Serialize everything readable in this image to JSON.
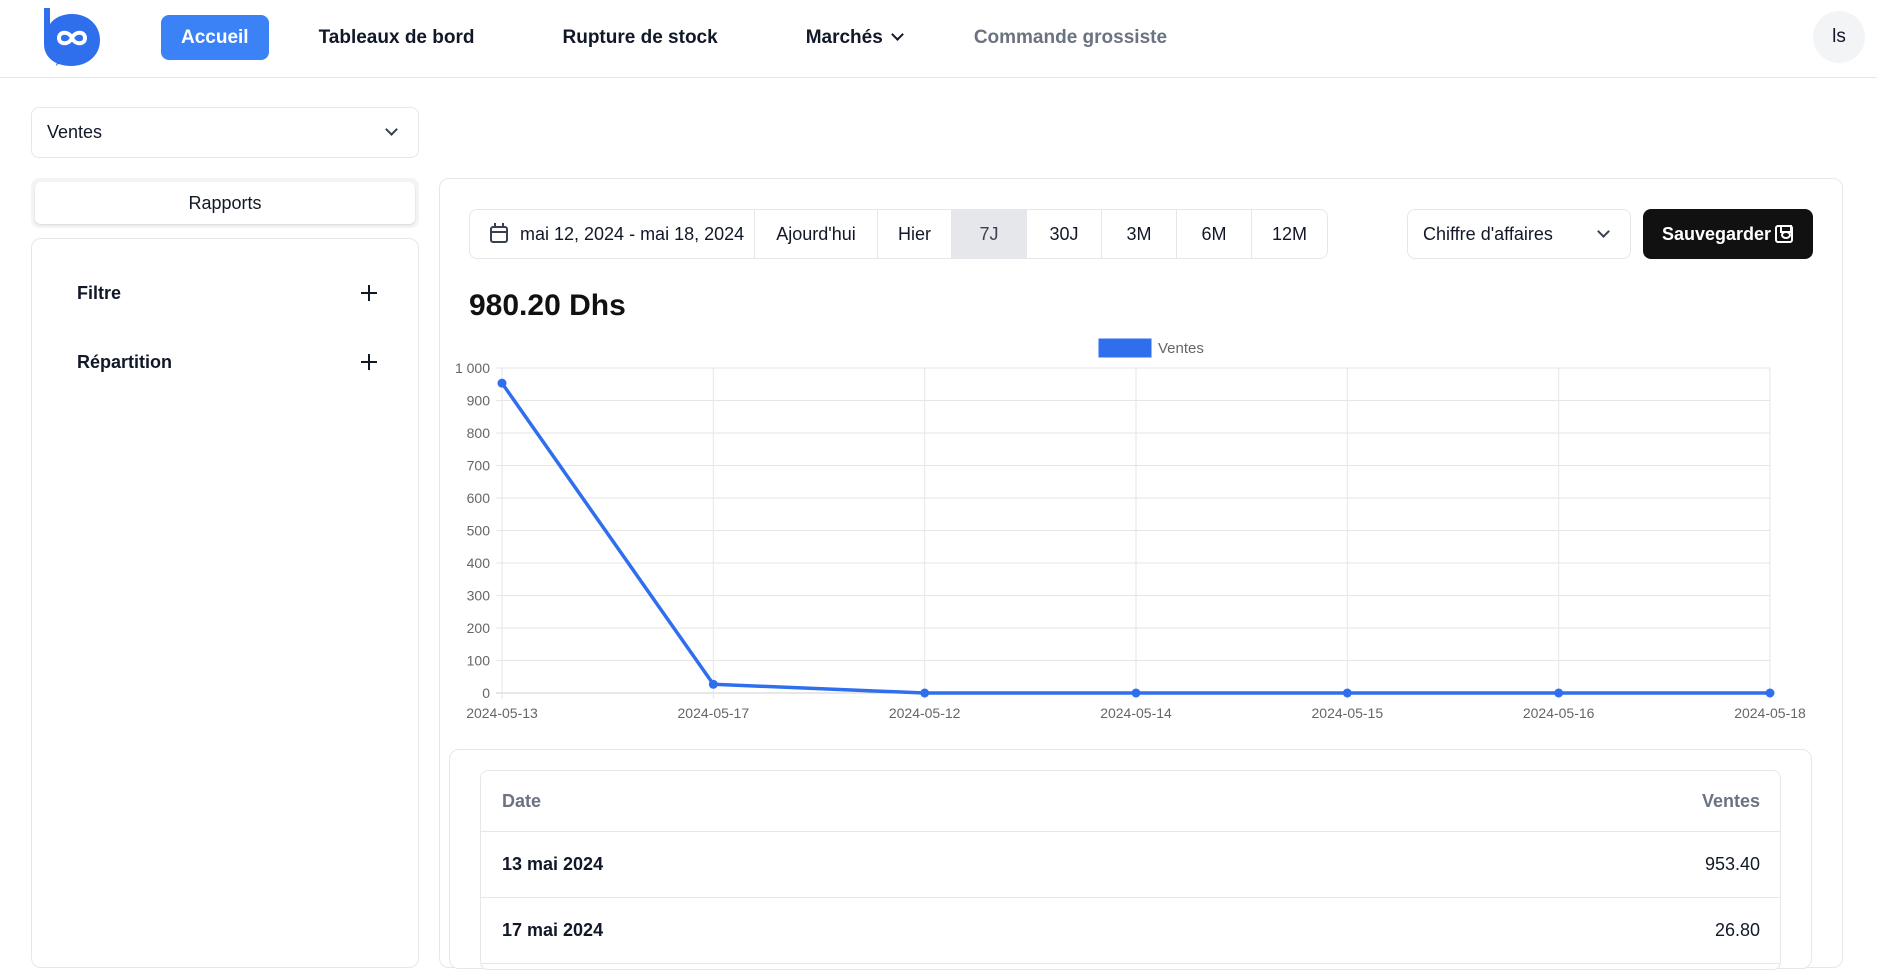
{
  "header": {
    "nav": [
      {
        "label": "Accueil"
      },
      {
        "label": "Tableaux de bord"
      },
      {
        "label": "Rupture de stock"
      },
      {
        "label": "Marchés"
      },
      {
        "label": "Commande grossiste"
      }
    ],
    "avatar_initials": "ls"
  },
  "sidebar": {
    "report_select": "Ventes",
    "tab_label": "Rapports",
    "sections": [
      {
        "label": "Filtre"
      },
      {
        "label": "Répartition"
      }
    ]
  },
  "toolbar": {
    "date_range": "mai 12, 2024 - mai 18, 2024",
    "ranges": [
      "Ajourd'hui",
      "Hier",
      "7J",
      "30J",
      "3M",
      "6M",
      "12M"
    ],
    "selected_range": "7J",
    "metric_select": "Chiffre d'affaires",
    "save_label": "Sauvegarder"
  },
  "summary": {
    "total": "980.20 Dhs"
  },
  "chart_data": {
    "type": "line",
    "x": [
      "2024-05-13",
      "2024-05-17",
      "2024-05-12",
      "2024-05-14",
      "2024-05-15",
      "2024-05-16",
      "2024-05-18"
    ],
    "series": [
      {
        "name": "Ventes",
        "values": [
          953.4,
          26.8,
          0,
          0,
          0,
          0,
          0
        ],
        "color": "#2f6fed"
      }
    ],
    "ylim": [
      0,
      1000
    ],
    "yticks": [
      0,
      100,
      200,
      300,
      400,
      500,
      600,
      700,
      800,
      900,
      1000
    ],
    "ytick_labels": [
      "0",
      "100",
      "200",
      "300",
      "400",
      "500",
      "600",
      "700",
      "800",
      "900",
      "1 000"
    ],
    "legend": "top-center",
    "grid": true
  },
  "table": {
    "columns": [
      "Date",
      "Ventes"
    ],
    "rows": [
      [
        "13 mai 2024",
        "953.40"
      ],
      [
        "17 mai 2024",
        "26.80"
      ]
    ]
  },
  "colors": {
    "accent": "#3b82f6",
    "series": "#2f6fed",
    "save_button": "#111111"
  }
}
